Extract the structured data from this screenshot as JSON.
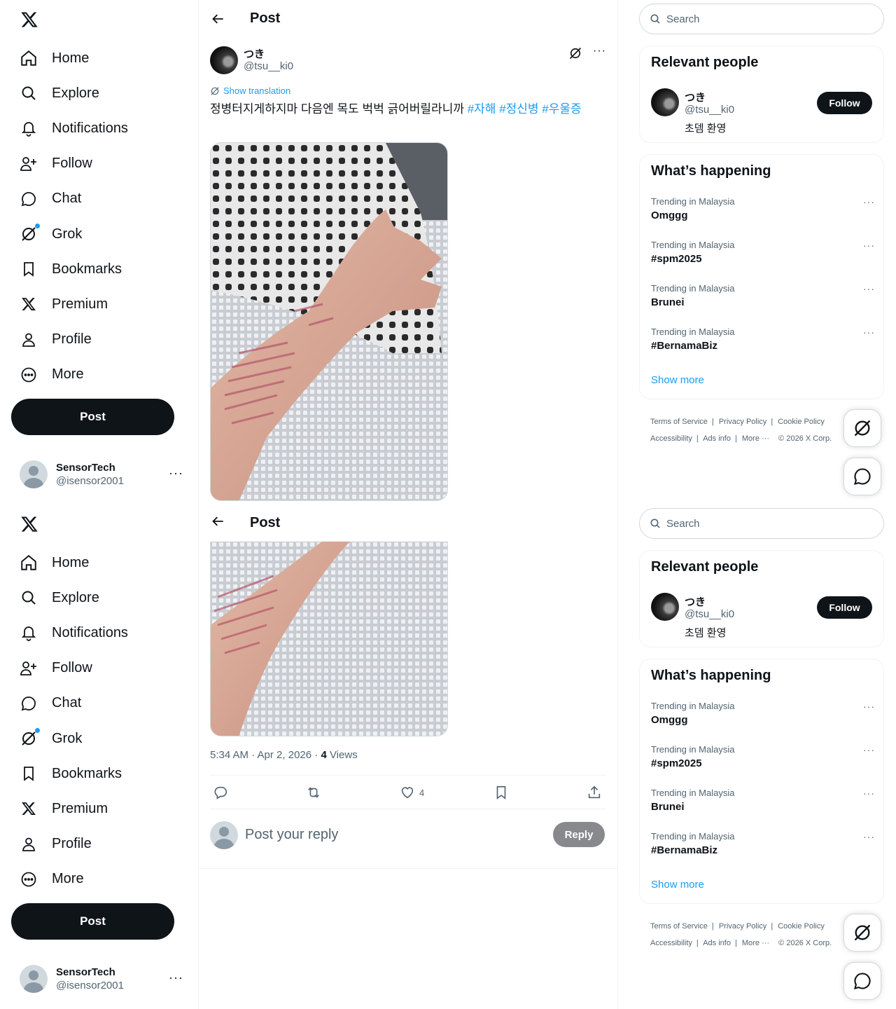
{
  "nav": {
    "items": [
      {
        "label": "Home",
        "icon": "home-icon"
      },
      {
        "label": "Explore",
        "icon": "search-icon"
      },
      {
        "label": "Notifications",
        "icon": "bell-icon"
      },
      {
        "label": "Follow",
        "icon": "follow-icon"
      },
      {
        "label": "Chat",
        "icon": "chat-icon"
      },
      {
        "label": "Grok",
        "icon": "grok-icon"
      },
      {
        "label": "Bookmarks",
        "icon": "bookmark-icon"
      },
      {
        "label": "Premium",
        "icon": "x-icon"
      },
      {
        "label": "Profile",
        "icon": "profile-icon"
      },
      {
        "label": "More",
        "icon": "more-circle-icon"
      }
    ],
    "post_label": "Post"
  },
  "account": {
    "name": "SensorTech",
    "handle": "@isensor2001"
  },
  "header": {
    "title": "Post"
  },
  "post": {
    "author_name": "つき",
    "author_handle": "@tsu__ki0",
    "show_translation": "Show translation",
    "text": "정병터지게하지마 다음엔 목도 벅벅 긁어버릴라니까 ",
    "hashtags": [
      "#자해",
      "#정신병",
      "#우울증"
    ],
    "time": "5:34 AM · Apr 2, 2026 · ",
    "views_count": "4",
    "views_label": " Views",
    "like_count": "4"
  },
  "reply": {
    "placeholder": "Post your reply",
    "button": "Reply"
  },
  "search": {
    "placeholder": "Search"
  },
  "relevant_people": {
    "title": "Relevant people",
    "name": "つき",
    "handle": "@tsu__ki0",
    "bio": "초뎀 환영",
    "follow_label": "Follow"
  },
  "whats_happening": {
    "title": "What’s happening",
    "trends": [
      {
        "context": "Trending in Malaysia",
        "topic": "Omggg"
      },
      {
        "context": "Trending in Malaysia",
        "topic": "#spm2025"
      },
      {
        "context": "Trending in Malaysia",
        "topic": "Brunei"
      },
      {
        "context": "Trending in Malaysia",
        "topic": "#BernamaBiz"
      }
    ],
    "show_more": "Show more"
  },
  "footer": {
    "terms": "Terms of Service",
    "privacy": "Privacy Policy",
    "cookie": "Cookie Policy",
    "accessibility": "Accessibility",
    "ads": "Ads info",
    "more": "More ···",
    "copyright": "© 2026 X Corp."
  },
  "colors": {
    "accent": "#1d9bf0",
    "text": "#0f1419",
    "secondary": "#536471"
  }
}
